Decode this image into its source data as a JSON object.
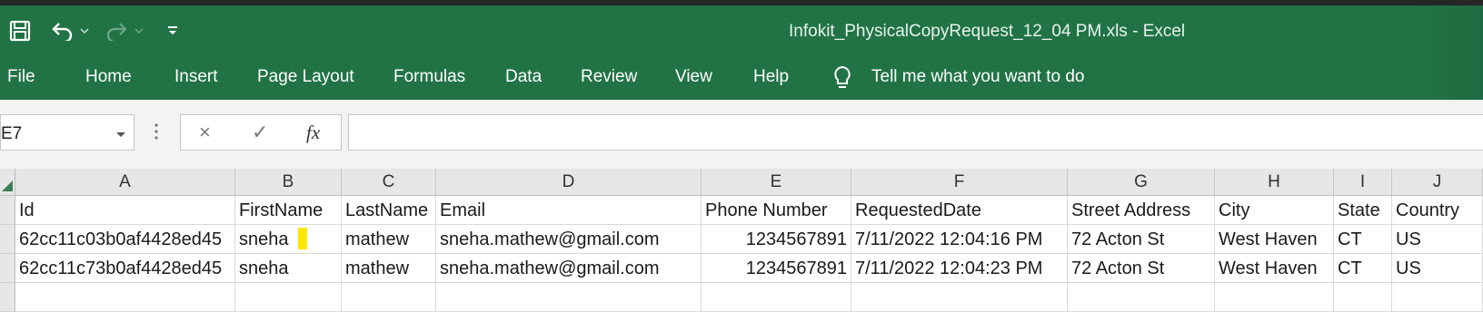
{
  "window": {
    "title": "Infokit_PhysicalCopyRequest_12_04 PM.xls  -  Excel"
  },
  "quick_access": [
    {
      "name": "save-icon",
      "label": "Save"
    },
    {
      "name": "undo-icon",
      "label": "Undo"
    },
    {
      "name": "redo-icon",
      "label": "Redo"
    },
    {
      "name": "customize-quick-access-icon",
      "label": "Customize Quick Access Toolbar"
    }
  ],
  "ribbon": {
    "tabs": [
      "File",
      "Home",
      "Insert",
      "Page Layout",
      "Formulas",
      "Data",
      "Review",
      "View",
      "Help"
    ],
    "tell_me": "Tell me what you want to do"
  },
  "formula_bar": {
    "name_box": "E7",
    "cancel": "×",
    "enter": "✓",
    "fx": "fx",
    "value": ""
  },
  "columns": [
    "A",
    "B",
    "C",
    "D",
    "E",
    "F",
    "G",
    "H",
    "I",
    "J"
  ],
  "headers": [
    "Id",
    "FirstName",
    "LastName",
    "Email",
    "Phone Number",
    "RequestedDate",
    "Street Address",
    "City",
    "State",
    "Country"
  ],
  "rows": [
    [
      "62cc11c03b0af4428ed45",
      "sneha",
      "mathew",
      "sneha.mathew@gmail.com",
      "1234567891",
      "7/11/2022 12:04:16 PM",
      "72 Acton St",
      "West Haven",
      "CT",
      "US"
    ],
    [
      "62cc11c73b0af4428ed45",
      "sneha",
      "mathew",
      "sneha.mathew@gmail.com",
      "1234567891",
      "7/11/2022 12:04:23 PM",
      "72 Acton St",
      "West Haven",
      "CT",
      "US"
    ]
  ],
  "colors": {
    "ribbon": "#217346",
    "highlight": "#ffe600"
  }
}
